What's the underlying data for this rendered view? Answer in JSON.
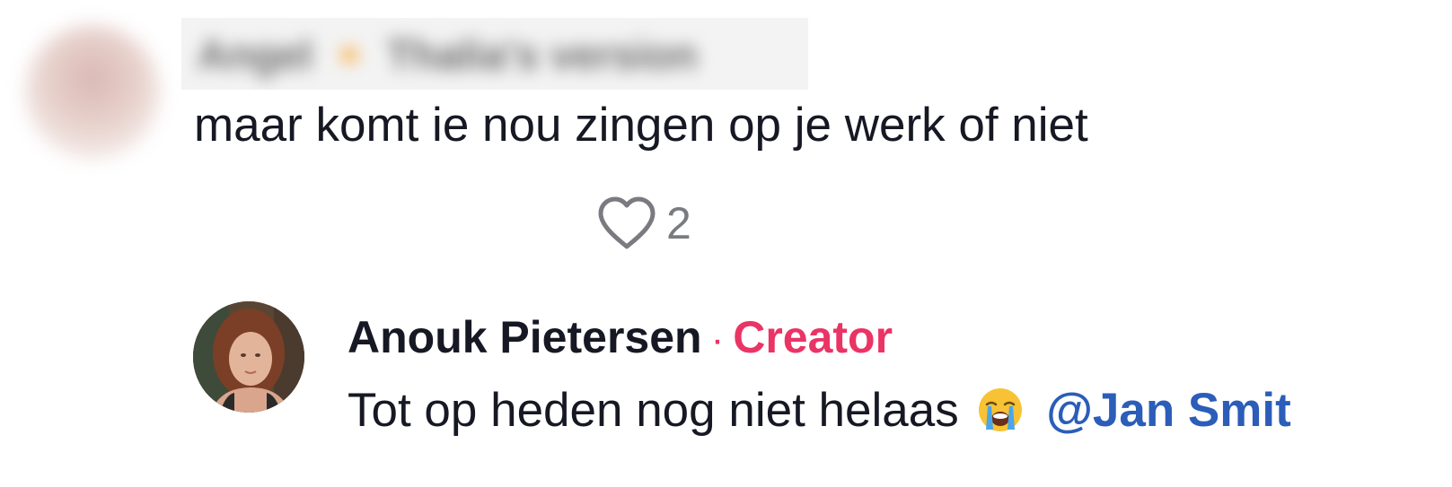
{
  "parent_comment": {
    "username": "Angel 🔸 Thalia's version",
    "text": "maar komt ie nou zingen op je werk of niet",
    "likes": "2"
  },
  "reply": {
    "author": "Anouk Pietersen",
    "separator": "·",
    "badge": "Creator",
    "text": "Tot op heden nog niet helaas",
    "emoji": "loudly-crying-face-emoji",
    "mention": "@Jan Smit"
  },
  "colors": {
    "creator_badge": "#ea3465",
    "mention": "#2b5db9",
    "like_count": "#7a7b80",
    "text": "#161823"
  }
}
